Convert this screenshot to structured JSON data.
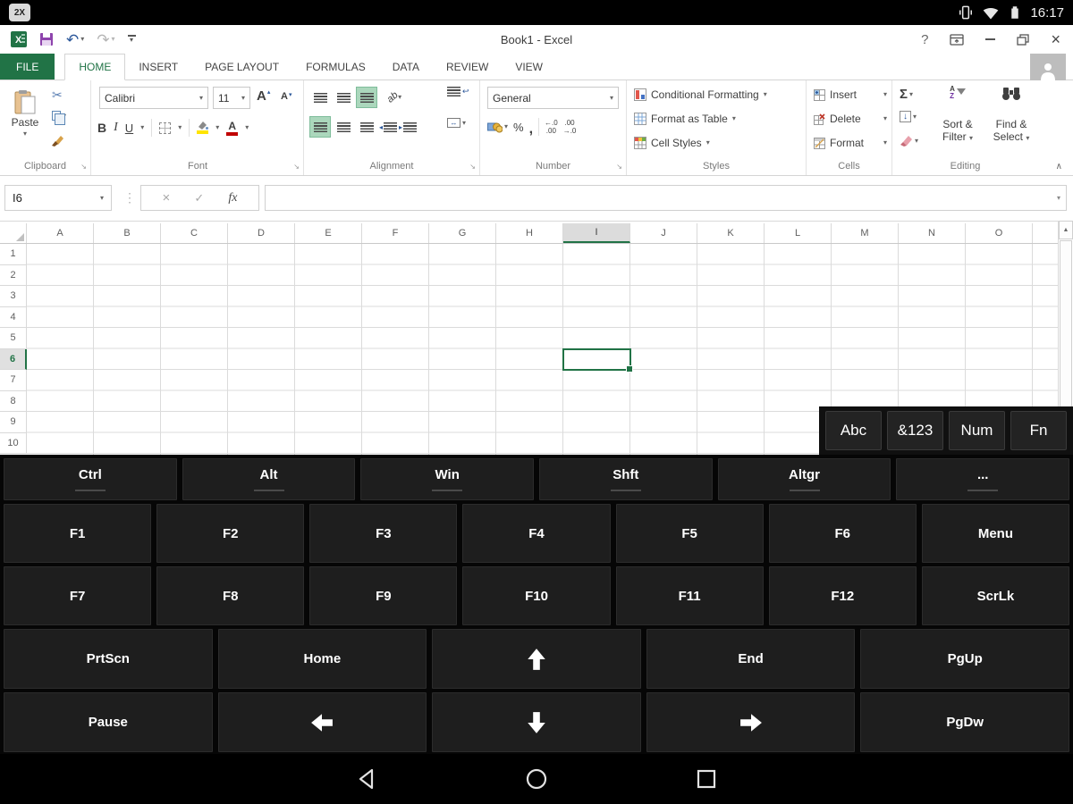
{
  "glyphs": {
    "dropdown": "▾",
    "caret_up": "▴",
    "scissors": "✂",
    "undo": "↶",
    "redo": "↷",
    "check": "✓",
    "cancel": "×",
    "sum": "Σ",
    "fill_down": "↓",
    "launcher": "↘",
    "collapse": "∧",
    "dots_v": "⋮",
    "wrap_return": "↩",
    "merge_arrows": "↔",
    "scroll_up": "▲",
    "sort_a": "A",
    "sort_z": "Z",
    "indent_out": "◂",
    "indent_in": "▸"
  },
  "status_bar": {
    "app_badge": "2X",
    "time": "16:17",
    "icons": [
      "vibrate-icon",
      "wifi-icon",
      "battery-icon"
    ]
  },
  "title_bar": {
    "title": "Book1 - Excel",
    "help": "?"
  },
  "ribbon_tabs": [
    {
      "label": "FILE",
      "file": true
    },
    {
      "label": "HOME",
      "active": true
    },
    {
      "label": "INSERT"
    },
    {
      "label": "PAGE LAYOUT"
    },
    {
      "label": "FORMULAS"
    },
    {
      "label": "DATA"
    },
    {
      "label": "REVIEW"
    },
    {
      "label": "VIEW"
    }
  ],
  "ribbon": {
    "clipboard": {
      "paste": "Paste",
      "group": "Clipboard"
    },
    "font": {
      "family": "Calibri",
      "size": "11",
      "bold": "B",
      "italic": "I",
      "underline": "U",
      "increase": "A",
      "decrease": "A",
      "color_a": "A",
      "group": "Font"
    },
    "alignment": {
      "orient": "ab",
      "group": "Alignment"
    },
    "number": {
      "format": "General",
      "percent": "%",
      "comma": ",",
      "inc_decimal": [
        "←.0",
        ".00"
      ],
      "dec_decimal": [
        ".00",
        "→.0"
      ],
      "group": "Number"
    },
    "styles": {
      "conditional": "Conditional Formatting",
      "table": "Format as Table",
      "cell_styles": "Cell Styles",
      "group": "Styles"
    },
    "cells": {
      "insert": "Insert",
      "delete": "Delete",
      "format": "Format",
      "group": "Cells"
    },
    "editing": {
      "sort_filter": "Sort & Filter",
      "find_select": "Find & Select",
      "group": "Editing"
    }
  },
  "formula_bar": {
    "name_box": "I6",
    "fx": "fx",
    "value": ""
  },
  "grid": {
    "columns": [
      "A",
      "B",
      "C",
      "D",
      "E",
      "F",
      "G",
      "H",
      "I",
      "J",
      "K",
      "L",
      "M",
      "N",
      "O"
    ],
    "rows": [
      "1",
      "2",
      "3",
      "4",
      "5",
      "6",
      "7",
      "8",
      "9",
      "10"
    ],
    "selected_column": "I",
    "selected_row": "6",
    "selected_cell": "I6"
  },
  "keyboard": {
    "mode_keys": [
      "Abc",
      "&123",
      "Num",
      "Fn"
    ],
    "rows": [
      {
        "name": "modifiers",
        "type": "mods",
        "underline": true,
        "keys": [
          "Ctrl",
          "Alt",
          "Win",
          "Shft",
          "Altgr",
          "..."
        ]
      },
      {
        "name": "fkeys-1",
        "type": "fk",
        "underline": false,
        "keys": [
          "F1",
          "F2",
          "F3",
          "F4",
          "F5",
          "F6",
          "Menu"
        ]
      },
      {
        "name": "fkeys-2",
        "type": "fk",
        "underline": false,
        "keys": [
          "F7",
          "F8",
          "F9",
          "F10",
          "F11",
          "F12",
          "ScrLk"
        ]
      },
      {
        "name": "nav-1",
        "type": "nav",
        "underline": false,
        "keys": [
          "PrtScn",
          "Home",
          "↑",
          "End",
          "PgUp"
        ]
      },
      {
        "name": "nav-2",
        "type": "nav",
        "underline": false,
        "keys": [
          "Pause",
          "←",
          "↓",
          "→",
          "PgDw"
        ]
      }
    ]
  },
  "android_nav": {
    "icons": [
      "back-icon",
      "home-icon",
      "recents-icon"
    ]
  },
  "colors": {
    "excel_green": "#217346",
    "selection_green": "#217346",
    "toggle_green": "#abd7bc",
    "key_bg": "#1e1e1e",
    "keyboard_bg": "#060606",
    "status_bar_bg": "#000000",
    "fill_yellow": "#ffe400",
    "font_red": "#c00000"
  }
}
